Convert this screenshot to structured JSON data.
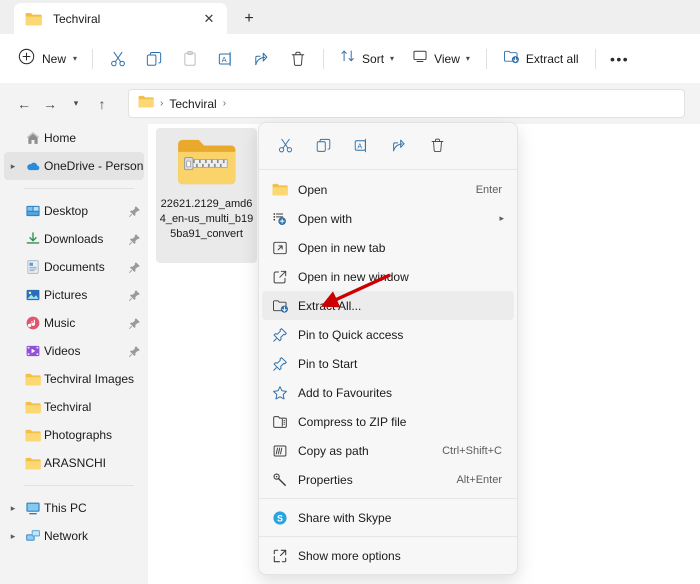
{
  "window": {
    "tab": {
      "title": "Techviral",
      "close_label": "✕",
      "icon": "folder-icon"
    },
    "new_tab_label": "+"
  },
  "toolbar": {
    "new_label": "New",
    "icons": [
      {
        "name": "cut-icon",
        "label": "Cut",
        "disabled": false
      },
      {
        "name": "copy-icon",
        "label": "Copy",
        "disabled": false
      },
      {
        "name": "paste-icon",
        "label": "Paste",
        "disabled": true
      },
      {
        "name": "rename-icon",
        "label": "Rename",
        "disabled": false
      },
      {
        "name": "share-icon",
        "label": "Share",
        "disabled": false
      },
      {
        "name": "delete-icon",
        "label": "Delete",
        "disabled": false
      }
    ],
    "sort_label": "Sort",
    "view_label": "View",
    "extract_all_label": "Extract all",
    "more_label": "•••"
  },
  "addressbar": {
    "back_label": "←",
    "forward_label": "→",
    "recent_label": "⌄",
    "up_label": "↑",
    "crumbs": [
      "Techviral"
    ],
    "separator": "›"
  },
  "sidebar": {
    "items": [
      {
        "label": "Home",
        "icon": "home-icon",
        "caret": false,
        "pin": false,
        "selected": false
      },
      {
        "label": "OneDrive - Persona",
        "icon": "onedrive-icon",
        "caret": true,
        "pin": false,
        "selected": true
      },
      {
        "divider": true
      },
      {
        "label": "Desktop",
        "icon": "desktop-icon",
        "caret": false,
        "pin": true,
        "selected": false
      },
      {
        "label": "Downloads",
        "icon": "downloads-icon",
        "caret": false,
        "pin": true,
        "selected": false
      },
      {
        "label": "Documents",
        "icon": "documents-icon",
        "caret": false,
        "pin": true,
        "selected": false
      },
      {
        "label": "Pictures",
        "icon": "pictures-icon",
        "caret": false,
        "pin": true,
        "selected": false
      },
      {
        "label": "Music",
        "icon": "music-icon",
        "caret": false,
        "pin": true,
        "selected": false
      },
      {
        "label": "Videos",
        "icon": "videos-icon",
        "caret": false,
        "pin": true,
        "selected": false
      },
      {
        "label": "Techviral Images",
        "icon": "folder-icon",
        "caret": false,
        "pin": false,
        "selected": false
      },
      {
        "label": "Techviral",
        "icon": "folder-icon",
        "caret": false,
        "pin": false,
        "selected": false
      },
      {
        "label": "Photographs",
        "icon": "folder-icon",
        "caret": false,
        "pin": false,
        "selected": false
      },
      {
        "label": "ARASNCHI",
        "icon": "folder-icon",
        "caret": false,
        "pin": false,
        "selected": false
      },
      {
        "divider": true
      },
      {
        "label": "This PC",
        "icon": "thispc-icon",
        "caret": true,
        "pin": false,
        "selected": false
      },
      {
        "label": "Network",
        "icon": "network-icon",
        "caret": true,
        "pin": false,
        "selected": false
      }
    ]
  },
  "content": {
    "file": {
      "name": "22621.2129_amd64_en-us_multi_b195ba91_convert",
      "icon": "zip-folder-icon",
      "selected": true
    }
  },
  "context_menu": {
    "icon_row": [
      {
        "name": "cut-icon",
        "label": "Cut"
      },
      {
        "name": "copy-icon",
        "label": "Copy"
      },
      {
        "name": "rename-icon",
        "label": "Rename"
      },
      {
        "name": "share-icon",
        "label": "Share"
      },
      {
        "name": "delete-icon",
        "label": "Delete"
      }
    ],
    "items": [
      {
        "label": "Open",
        "icon": "folder-icon",
        "accel": "Enter",
        "submenu": false,
        "highlighted": false
      },
      {
        "label": "Open with",
        "icon": "open-with-icon",
        "accel": "",
        "submenu": true,
        "highlighted": false
      },
      {
        "label": "Open in new tab",
        "icon": "new-tab-icon",
        "accel": "",
        "submenu": false,
        "highlighted": false
      },
      {
        "label": "Open in new window",
        "icon": "new-window-icon",
        "accel": "",
        "submenu": false,
        "highlighted": false
      },
      {
        "label": "Extract All...",
        "icon": "extract-all-icon",
        "accel": "",
        "submenu": false,
        "highlighted": true
      },
      {
        "label": "Pin to Quick access",
        "icon": "pin-icon",
        "accel": "",
        "submenu": false,
        "highlighted": false
      },
      {
        "label": "Pin to Start",
        "icon": "pin-icon",
        "accel": "",
        "submenu": false,
        "highlighted": false
      },
      {
        "label": "Add to Favourites",
        "icon": "star-icon",
        "accel": "",
        "submenu": false,
        "highlighted": false
      },
      {
        "label": "Compress to ZIP file",
        "icon": "compress-zip-icon",
        "accel": "",
        "submenu": false,
        "highlighted": false
      },
      {
        "label": "Copy as path",
        "icon": "copy-as-path-icon",
        "accel": "Ctrl+Shift+C",
        "submenu": false,
        "highlighted": false
      },
      {
        "label": "Properties",
        "icon": "properties-icon",
        "accel": "Alt+Enter",
        "submenu": false,
        "highlighted": false
      },
      {
        "divider": true
      },
      {
        "label": "Share with Skype",
        "icon": "skype-icon",
        "accel": "",
        "submenu": false,
        "highlighted": false
      },
      {
        "divider": true
      },
      {
        "label": "Show more options",
        "icon": "show-more-icon",
        "accel": "",
        "submenu": false,
        "highlighted": false
      }
    ]
  },
  "annotation": {
    "arrow_color": "#cc0000",
    "points_to": "Extract All..."
  }
}
